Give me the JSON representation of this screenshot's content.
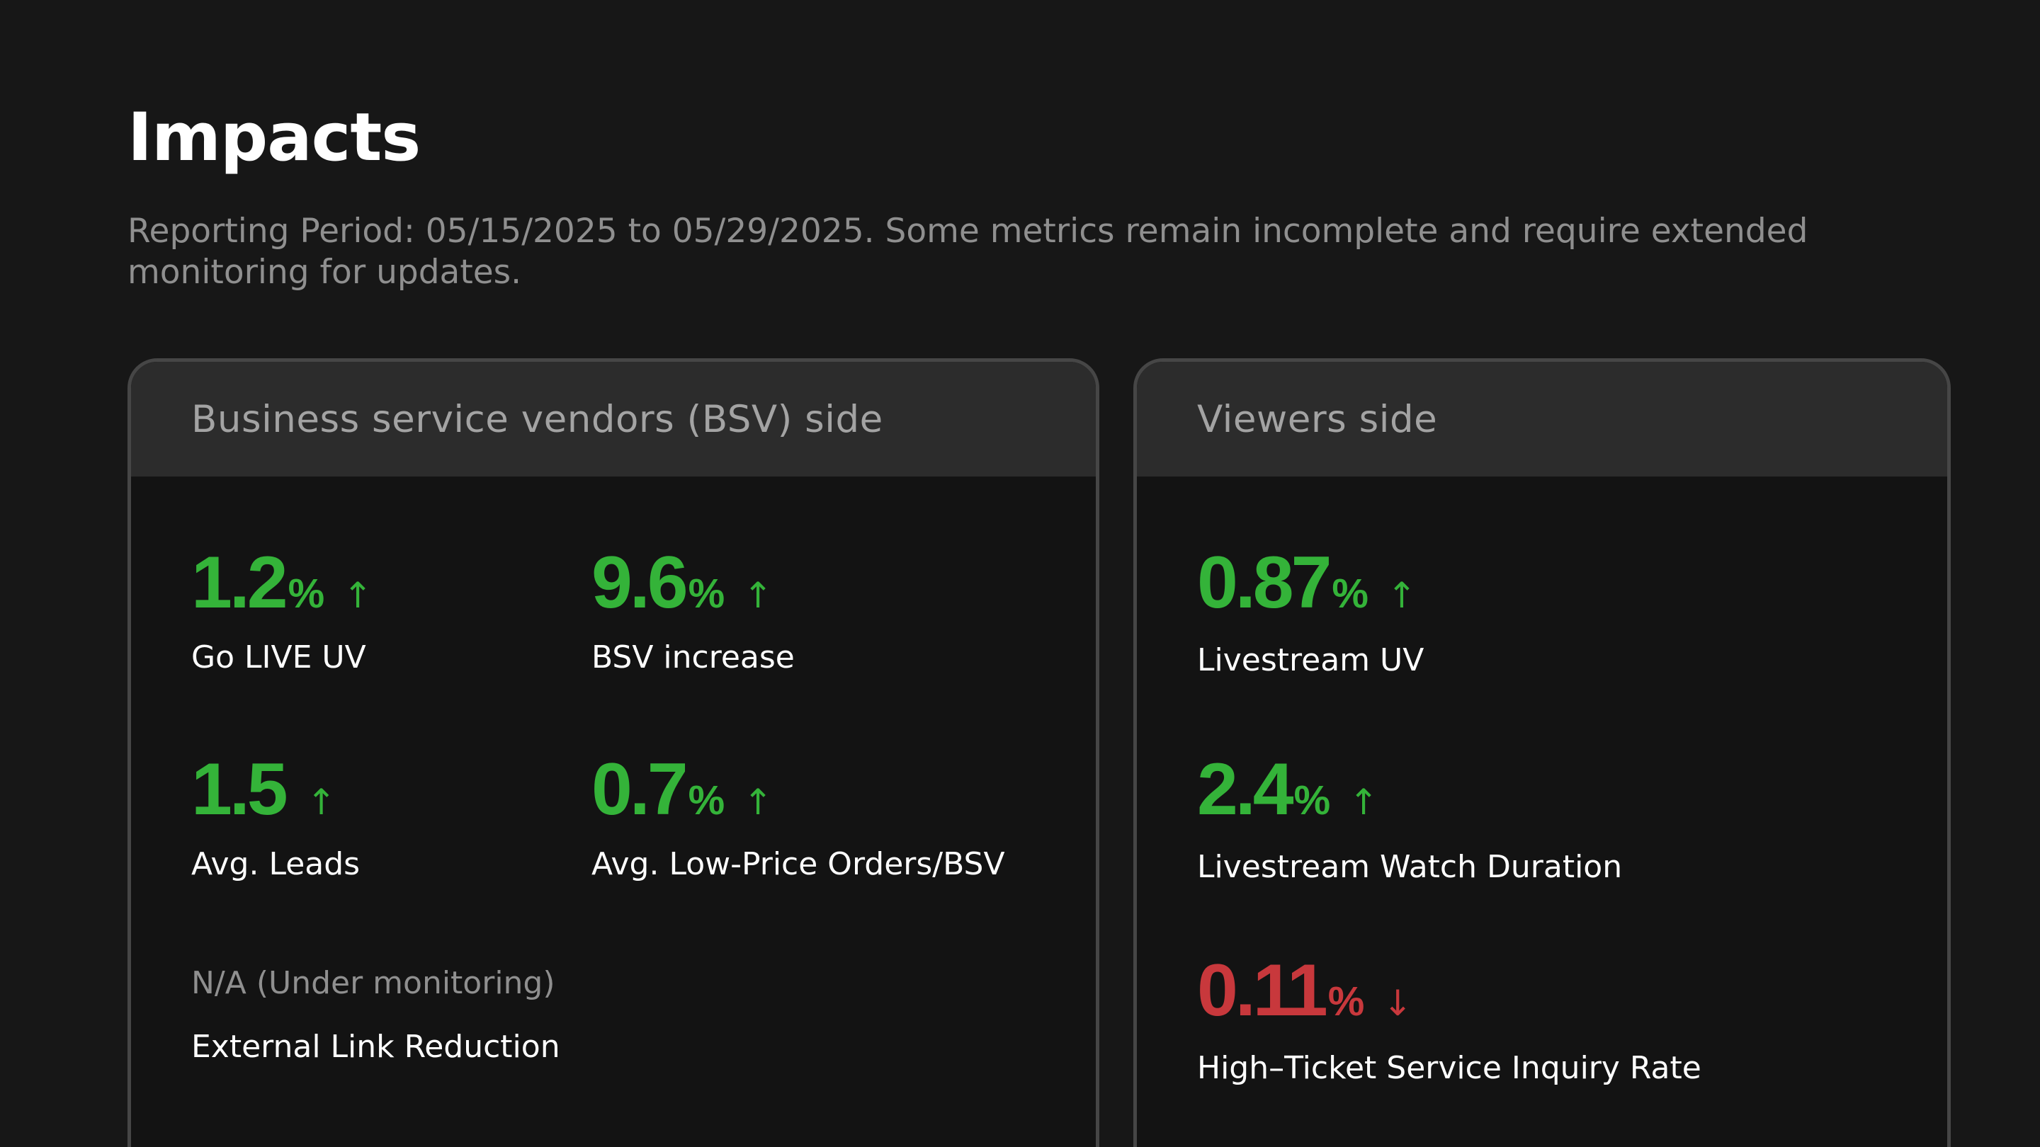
{
  "title": "Impacts",
  "subtitle": "Reporting Period: 05/15/2025 to 05/29/2025. Some metrics remain incomplete and require extended monitoring for updates.",
  "colors": {
    "positive": "#34b339",
    "negative": "#c8383c",
    "background": "#171717"
  },
  "bsv": {
    "header": "Business service vendors (BSV) side",
    "metrics": [
      {
        "value": "1.2",
        "unit": "%",
        "arrow": "↑",
        "label": "Go LIVE UV"
      },
      {
        "value": "9.6",
        "unit": "%",
        "arrow": "↑",
        "label": "BSV increase"
      },
      {
        "value": "1.5",
        "unit": "",
        "arrow": "↑",
        "label": "Avg. Leads"
      },
      {
        "value": "0.7",
        "unit": "%",
        "arrow": "↑",
        "label": "Avg. Low-Price Orders/BSV"
      },
      {
        "status": "N/A (Under monitoring)",
        "label": "External Link Reduction"
      }
    ]
  },
  "viewers": {
    "header": "Viewers side",
    "metrics": [
      {
        "value": "0.87",
        "unit": "%",
        "arrow": "↑",
        "label": "Livestream UV"
      },
      {
        "value": "2.4",
        "unit": "%",
        "arrow": "↑",
        "label": "Livestream Watch Duration"
      },
      {
        "value": "0.11",
        "unit": "%",
        "arrow": "↓",
        "label": "High–Ticket Service Inquiry Rate"
      }
    ]
  }
}
